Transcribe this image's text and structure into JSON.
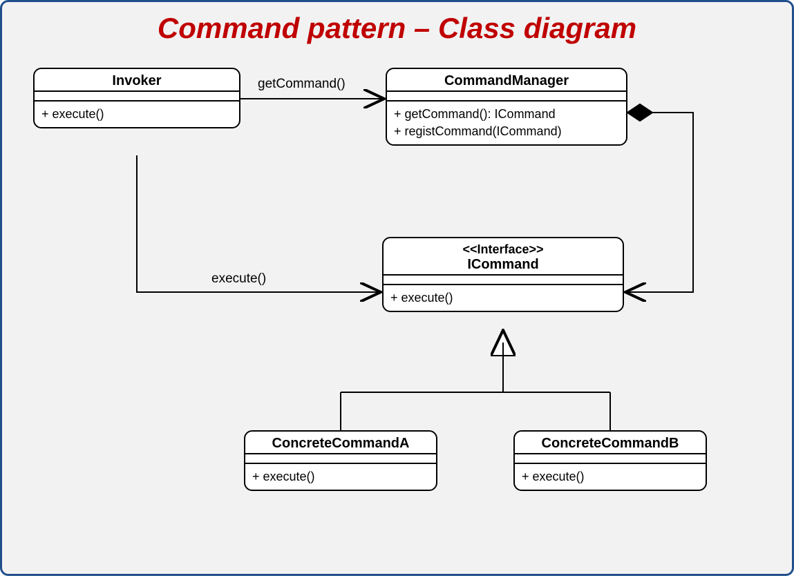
{
  "title": "Command pattern – Class diagram",
  "classes": {
    "invoker": {
      "name": "Invoker",
      "methods": [
        "+ execute()"
      ]
    },
    "commandManager": {
      "name": "CommandManager",
      "methods": [
        "+ getCommand(): ICommand",
        "+ registCommand(ICommand)"
      ]
    },
    "icommand": {
      "stereotype": "<<Interface>>",
      "name": "ICommand",
      "methods": [
        "+ execute()"
      ]
    },
    "concreteA": {
      "name": "ConcreteCommandA",
      "methods": [
        "+ execute()"
      ]
    },
    "concreteB": {
      "name": "ConcreteCommandB",
      "methods": [
        "+ execute()"
      ]
    }
  },
  "edges": {
    "invokerToManager": "getCommand()",
    "invokerToICommand": "execute()"
  }
}
